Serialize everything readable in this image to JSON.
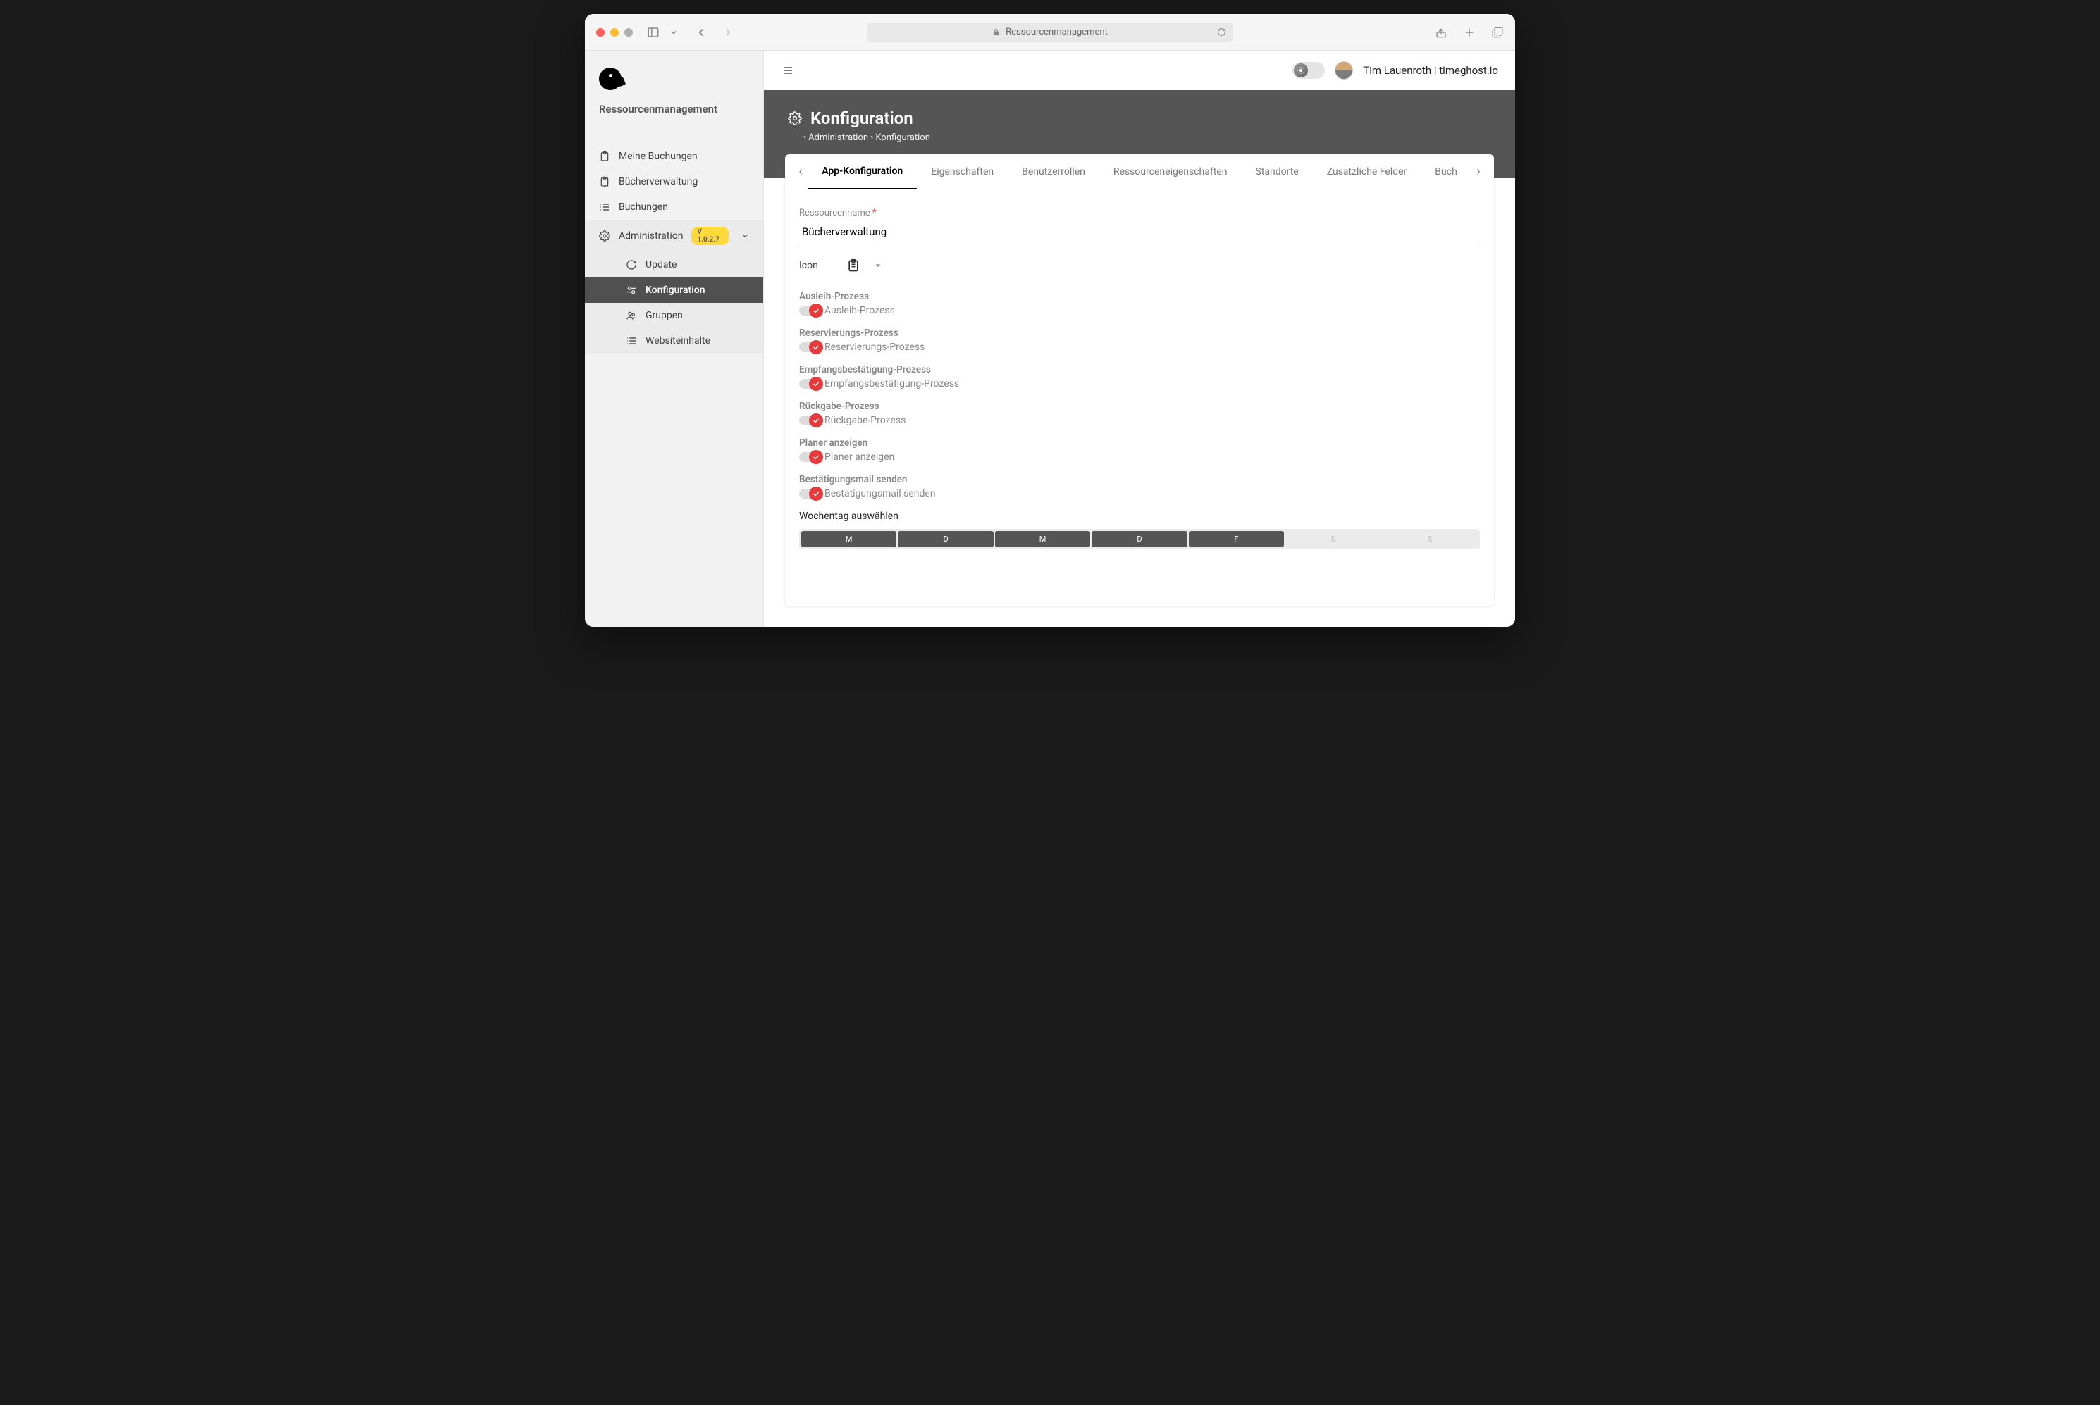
{
  "browser": {
    "address": "Ressourcenmanagement"
  },
  "app": {
    "title": "Ressourcenmanagement",
    "user_label": "Tim Lauenroth | timeghost.io"
  },
  "sidebar": {
    "items": [
      {
        "label": "Meine Buchungen"
      },
      {
        "label": "Bücherverwaltung"
      },
      {
        "label": "Buchungen"
      }
    ],
    "admin": {
      "label": "Administration",
      "version": "V 1.0.2.7",
      "children": [
        {
          "label": "Update"
        },
        {
          "label": "Konfiguration"
        },
        {
          "label": "Gruppen"
        },
        {
          "label": "Websiteinhalte"
        }
      ]
    }
  },
  "hero": {
    "title": "Konfiguration",
    "breadcrumb": "Administration  ›  Konfiguration"
  },
  "tabs": [
    "App-Konfiguration",
    "Eigenschaften",
    "Benutzerrollen",
    "Ressourceneigenschaften",
    "Standorte",
    "Zusätzliche Felder",
    "Buch"
  ],
  "form": {
    "resource_name_label": "Ressourcenname",
    "resource_name_value": "Bücherverwaltung",
    "icon_label": "Icon",
    "processes": [
      {
        "section": "Ausleih-Prozess",
        "toggle_label": "Ausleih-Prozess"
      },
      {
        "section": "Reservierungs-Prozess",
        "toggle_label": "Reservierungs-Prozess"
      },
      {
        "section": "Empfangsbestätigung-Prozess",
        "toggle_label": "Empfangsbestätigung-Prozess"
      },
      {
        "section": "Rückgabe-Prozess",
        "toggle_label": "Rückgabe-Prozess"
      },
      {
        "section": "Planer anzeigen",
        "toggle_label": "Planer anzeigen"
      },
      {
        "section": "Bestätigungsmail senden",
        "toggle_label": "Bestätigungsmail senden"
      }
    ],
    "weekday_label": "Wochentag auswählen",
    "weekdays": [
      {
        "label": "M",
        "on": true
      },
      {
        "label": "D",
        "on": true
      },
      {
        "label": "M",
        "on": true
      },
      {
        "label": "D",
        "on": true
      },
      {
        "label": "F",
        "on": true
      },
      {
        "label": "S",
        "on": false
      },
      {
        "label": "S",
        "on": false
      }
    ]
  }
}
